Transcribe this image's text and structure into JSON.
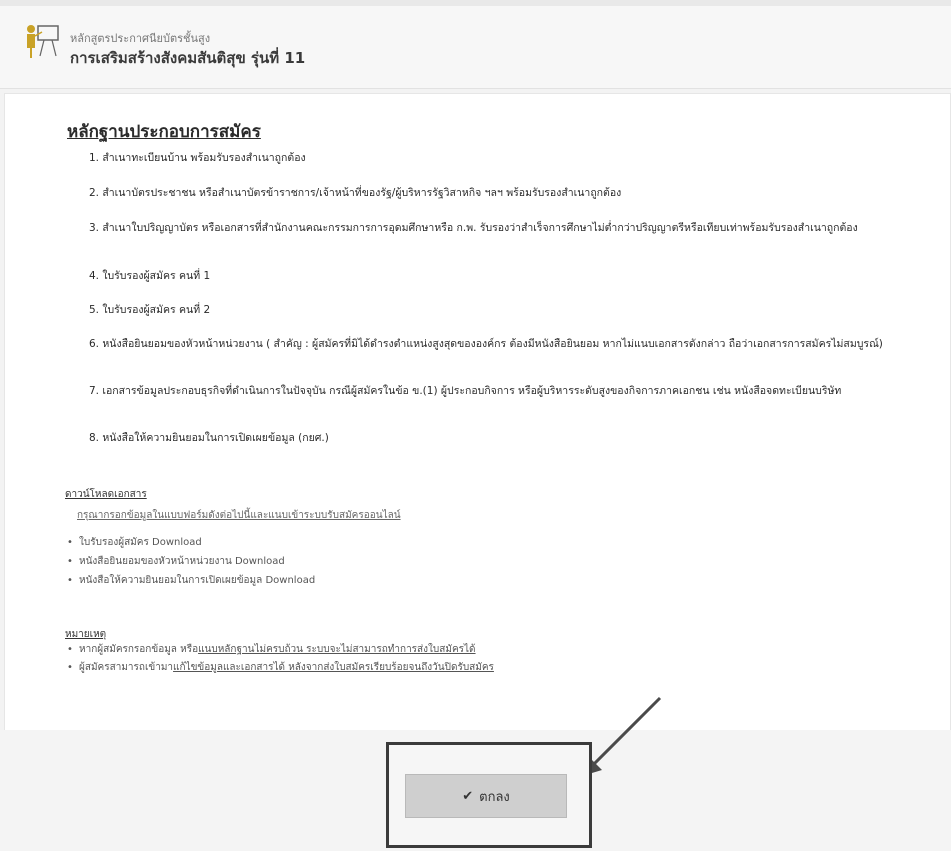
{
  "header": {
    "subtitle": "หลักสูตรประกาศนียบัตรชั้นสูง",
    "title": "การเสริมสร้างสังคมสันติสุข รุ่นที่ 11"
  },
  "section_title": "หลักฐานประกอบการสมัคร",
  "requirements": [
    "1. สำเนาทะเบียนบ้าน พร้อมรับรองสำเนาถูกต้อง",
    "2. สำเนาบัตรประชาชน หรือสำเนาบัตรข้าราชการ/เจ้าหน้าที่ของรัฐ/ผู้บริหารรัฐวิสาหกิจ ฯลฯ พร้อมรับรองสำเนาถูกต้อง",
    "3. สำเนาใบปริญญาบัตร หรือเอกสารที่สำนักงานคณะกรรมการการอุดมศึกษาหรือ ก.พ. รับรองว่าสำเร็จการศึกษาไม่ต่ำกว่าปริญญาตรีหรือเทียบเท่าพร้อมรับรองสำเนาถูกต้อง",
    "4. ใบรับรองผู้สมัคร คนที่ 1",
    "5. ใบรับรองผู้สมัคร คนที่ 2",
    "6. หนังสือยินยอมของหัวหน้าหน่วยงาน ( สำคัญ : ผู้สมัครที่มิได้ดำรงตำแหน่งสูงสุดขององค์กร ต้องมีหนังสือยินยอม หากไม่แนบเอกสารดังกล่าว ถือว่าเอกสารการสมัครไม่สมบูรณ์)",
    "7. เอกสารข้อมูลประกอบธุรกิจที่ดำเนินการในปัจจุบัน กรณีผู้สมัครในข้อ ข.(1) ผู้ประกอบกิจการ หรือผู้บริหารระดับสูงของกิจการภาคเอกชน เช่น หนังสือจดทะเบียนบริษัท",
    "8. หนังสือให้ความยินยอมในการเปิดเผยข้อมูล (กยศ.)"
  ],
  "downloads": {
    "heading": "ดาวน์โหลดเอกสาร",
    "instruction": "กรุณากรอกข้อมูลในแบบฟอร์มดังต่อไปนี้และแนบเข้าระบบรับสมัครออนไลน์",
    "items": [
      {
        "name": "ใบรับรองผู้สมัคร",
        "link": "Download"
      },
      {
        "name": "หนังสือยินยอมของหัวหน้าหน่วยงาน",
        "link": "Download"
      },
      {
        "name": "หนังสือให้ความยินยอมในการเปิดเผยข้อมูล",
        "link": "Download"
      }
    ]
  },
  "notes": {
    "heading": "หมายเหตุ",
    "items": [
      {
        "prefix": "หากผู้สมัครกรอกข้อมูล หรือ",
        "link": "แนบหลักฐานไม่ครบถ้วน ระบบจะไม่สามารถทำการส่งใบสมัครได้"
      },
      {
        "prefix": "ผู้สมัครสามารถเข้ามา",
        "link": "แก้ไขข้อมูลและเอกสารได้ หลังจากส่งใบสมัครเรียบร้อยจนถึงวันปิดรับสมัคร"
      }
    ]
  },
  "ok_button_label": "ตกลง",
  "colors": {
    "button_bg": "#cfcfcf",
    "highlight_border": "#3b3b3b",
    "page_bg": "#f3f3f3"
  }
}
